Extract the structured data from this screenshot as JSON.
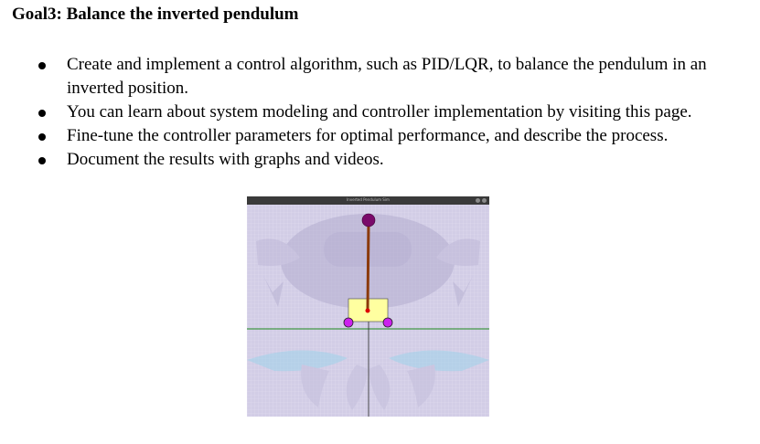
{
  "heading": "Goal3: Balance the inverted pendulum",
  "bullets": [
    "Create and implement a control algorithm, such as PID/LQR, to balance the pendulum in an inverted position.",
    "You can learn about system modeling and controller implementation by visiting this page.",
    "Fine-tune the controller parameters for optimal performance, and describe the process.",
    "Document the results with graphs and videos."
  ],
  "simulator": {
    "window_title": "Inverted Pendulum Sim",
    "colors": {
      "background": "#d2cde6",
      "grid": "#e2def0",
      "ground_line": "#1e8c1e",
      "vertical_axis": "#222222",
      "cart": "#ffffa0",
      "wheel": "#cc22ee",
      "rod": "#8b3a0a",
      "bob": "#7a0a6a",
      "pivot": "#dd0000"
    }
  }
}
